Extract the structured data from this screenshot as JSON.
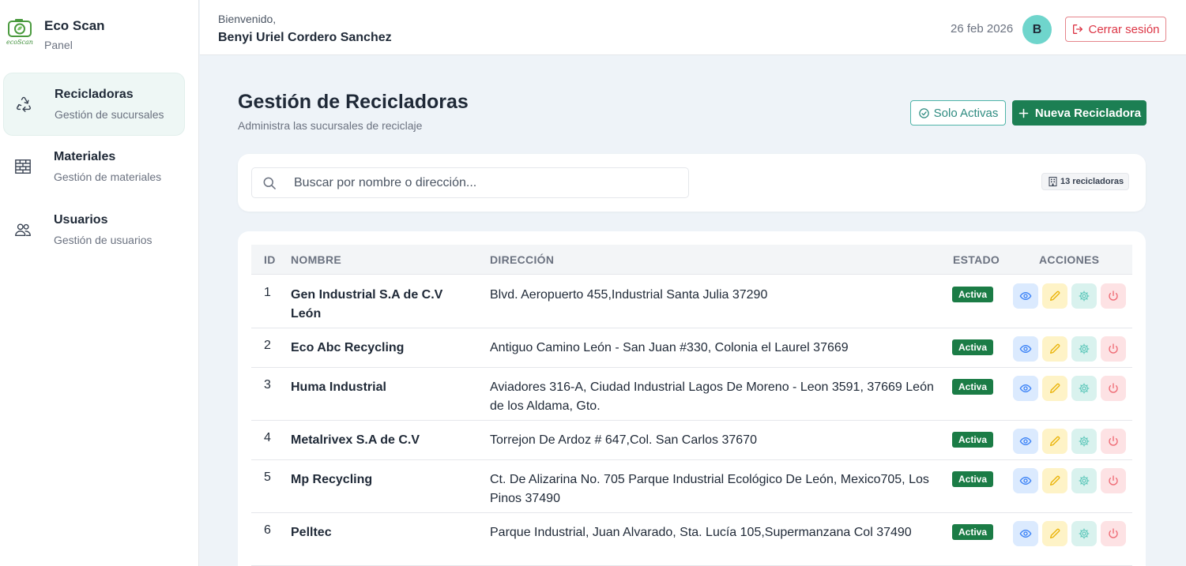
{
  "brand": {
    "title": "Eco Scan",
    "subtitle": "Panel",
    "logo_text": "ecoScan"
  },
  "sidebar": {
    "items": [
      {
        "label": "Recicladoras",
        "sub": "Gestión de sucursales",
        "icon": "recycle-icon",
        "active": true
      },
      {
        "label": "Materiales",
        "sub": "Gestión de materiales",
        "icon": "bricks-icon",
        "active": false
      },
      {
        "label": "Usuarios",
        "sub": "Gestión de usuarios",
        "icon": "users-icon",
        "active": false
      }
    ]
  },
  "header": {
    "welcome": "Bienvenido,",
    "user_name": "Benyi Uriel Cordero Sanchez",
    "date": "26 feb 2026",
    "avatar_initial": "B",
    "logout_label": "Cerrar sesión"
  },
  "main": {
    "title": "Gestión de Recicladoras",
    "subtitle": "Administra las sucursales de reciclaje",
    "filter_label": "Solo Activas",
    "new_label": "Nueva Recicladora",
    "search_placeholder": "Buscar por nombre o dirección...",
    "count_label": "13 recicladoras"
  },
  "table": {
    "headers": {
      "id": "ID",
      "name": "NOMBRE",
      "address": "DIRECCIÓN",
      "state": "ESTADO",
      "actions": "ACCIONES"
    },
    "rows": [
      {
        "id": "1",
        "name": "Gen Industrial S.A de C.V León",
        "address": "Blvd. Aeropuerto 455,Industrial Santa Julia 37290",
        "state": "Activa"
      },
      {
        "id": "2",
        "name": "Eco Abc Recycling",
        "address": "Antiguo Camino León - San Juan #330, Colonia el Laurel 37669",
        "state": "Activa"
      },
      {
        "id": "3",
        "name": "Huma Industrial",
        "address": "Aviadores 316-A, Ciudad Industrial Lagos De Moreno - Leon 3591, 37669 León de los Aldama, Gto.",
        "state": "Activa"
      },
      {
        "id": "4",
        "name": "Metalrivex S.A de C.V",
        "address": "Torrejon De Ardoz # 647,Col. San Carlos 37670",
        "state": "Activa"
      },
      {
        "id": "5",
        "name": "Mp Recycling",
        "address": "Ct. De Alizarina No. 705 Parque Industrial Ecológico De León, Mexico705, Los Pinos 37490",
        "state": "Activa"
      },
      {
        "id": "6",
        "name": "Pelltec",
        "address": "Parque Industrial, Juan Alvarado, Sta. Lucía 105,Supermanzana Col 37490",
        "state": "Activa"
      }
    ]
  },
  "colors": {
    "primary": "#1c7f53",
    "active_badge": "#1b7c46",
    "logout": "#dc3545",
    "avatar": "#6fd5cc",
    "filter": "#2e8b80"
  }
}
